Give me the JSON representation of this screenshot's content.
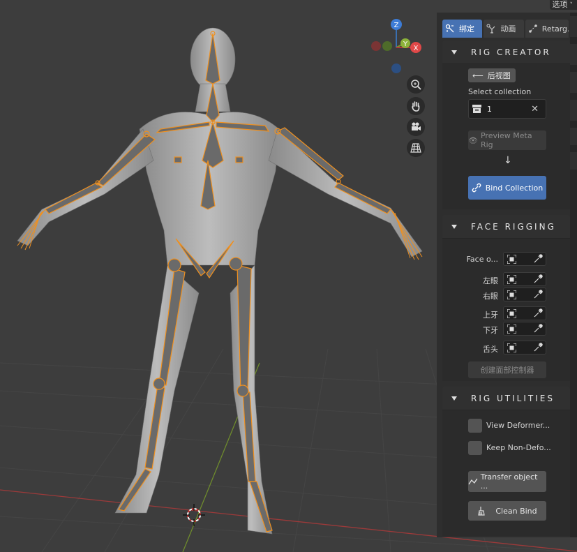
{
  "app": {
    "options_label": "选项"
  },
  "viewport": {
    "gizmo": {
      "z": "Z",
      "y": "Y",
      "x": "X"
    },
    "tool_icons": [
      "zoom-icon",
      "hand-icon",
      "camera-icon",
      "grid-icon"
    ],
    "colors": {
      "background": "#3d3d3d",
      "armature": "#f0901e",
      "x_axis": "#9c3a3a",
      "y_axis": "#6e8b2d"
    }
  },
  "panel": {
    "tabs": [
      {
        "label": "绑定",
        "icon": "rig-icon",
        "active": true
      },
      {
        "label": "动画",
        "icon": "animation-icon",
        "active": false
      },
      {
        "label": "Retarg...",
        "icon": "retarget-icon",
        "active": false
      }
    ],
    "rig_creator": {
      "title": "RIG CREATOR",
      "back_view": "后视图",
      "select_collection_label": "Select collection",
      "collection_value": "1",
      "preview_button": "Preview Meta Rig",
      "bind_button": "Bind Collection"
    },
    "face_rigging": {
      "title": "FACE RIGGING",
      "rows": [
        {
          "label": "Face o..."
        },
        {
          "label": "左眼"
        },
        {
          "label": "右眼"
        },
        {
          "label": "上牙"
        },
        {
          "label": "下牙"
        },
        {
          "label": "舌头"
        }
      ],
      "create_button": "创建面部控制器"
    },
    "rig_utilities": {
      "title": "RIG UTILITIES",
      "view_deformer": "View Deformer...",
      "keep_non_deform": "Keep Non-Defo...",
      "transfer_button": "Transfer object ...",
      "clean_bind_button": "Clean Bind"
    },
    "accent_color": "#4772b3"
  }
}
